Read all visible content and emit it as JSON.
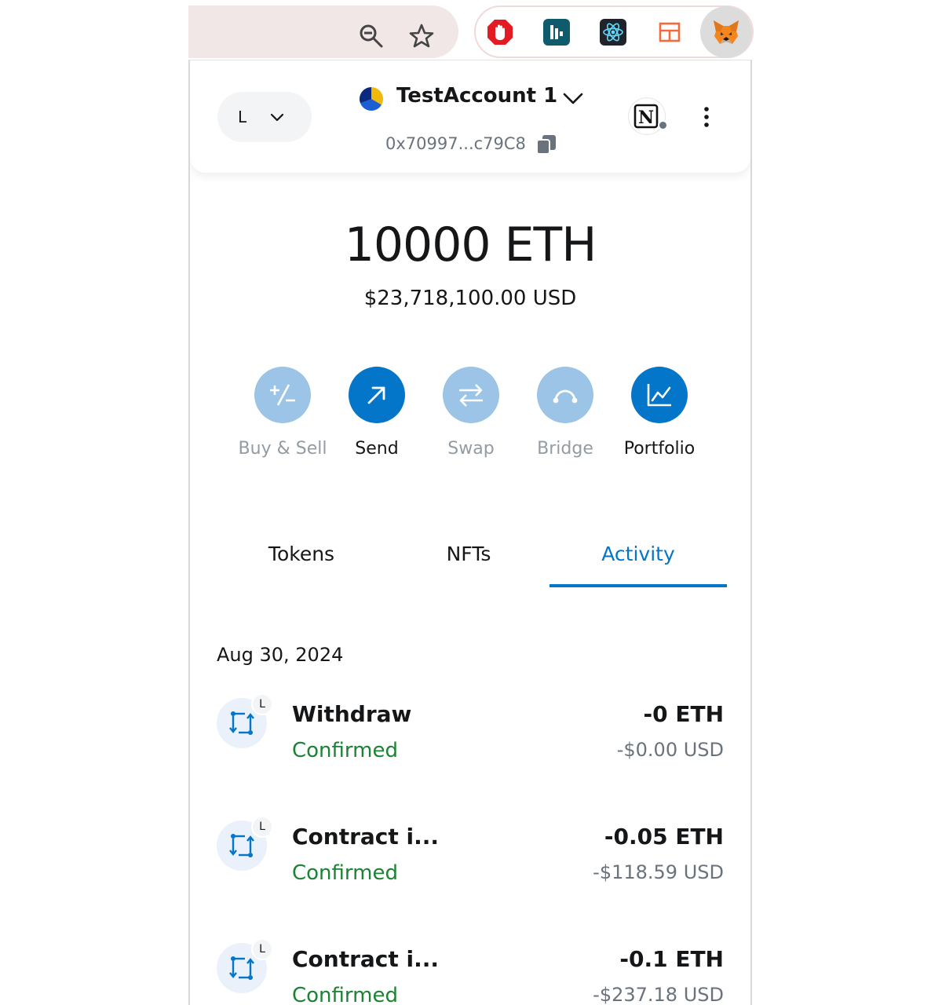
{
  "browser": {
    "toolbar_icons": [
      "zoom-out-icon",
      "bookmark-star-icon"
    ],
    "extensions": [
      "adblock-extension-icon",
      "bookmark-extension-icon",
      "react-devtools-extension-icon",
      "layout-extension-icon",
      "metamask-fox-icon"
    ]
  },
  "header": {
    "network_letter": "L",
    "account_name": "TestAccount 1",
    "account_address": "0x70997...c79C8",
    "site_icon_letter": "N"
  },
  "balance": {
    "eth": "10000 ETH",
    "usd": "$23,718,100.00 USD"
  },
  "actions": [
    {
      "label": "Buy & Sell",
      "icon": "plus-minus-icon",
      "enabled": false
    },
    {
      "label": "Send",
      "icon": "arrow-up-right-icon",
      "enabled": true
    },
    {
      "label": "Swap",
      "icon": "swap-arrows-icon",
      "enabled": false
    },
    {
      "label": "Bridge",
      "icon": "bridge-icon",
      "enabled": false
    },
    {
      "label": "Portfolio",
      "icon": "chart-icon",
      "enabled": true
    }
  ],
  "tabs": [
    {
      "label": "Tokens",
      "selected": false
    },
    {
      "label": "NFTs",
      "selected": false
    },
    {
      "label": "Activity",
      "selected": true
    }
  ],
  "activity": {
    "date": "Aug 30, 2024",
    "transactions": [
      {
        "title": "Withdraw",
        "status": "Confirmed",
        "amount": "-0 ETH",
        "fiat": "-$0.00 USD",
        "badge": "L"
      },
      {
        "title": "Contract i...",
        "status": "Confirmed",
        "amount": "-0.05 ETH",
        "fiat": "-$118.59 USD",
        "badge": "L"
      },
      {
        "title": "Contract i...",
        "status": "Confirmed",
        "amount": "-0.1 ETH",
        "fiat": "-$237.18 USD",
        "badge": "L"
      }
    ]
  },
  "colors": {
    "primary_blue": "#0376c9",
    "disabled_blue": "#9cc4e6",
    "confirmed_green": "#1c8234",
    "muted_text": "#6a737d"
  }
}
